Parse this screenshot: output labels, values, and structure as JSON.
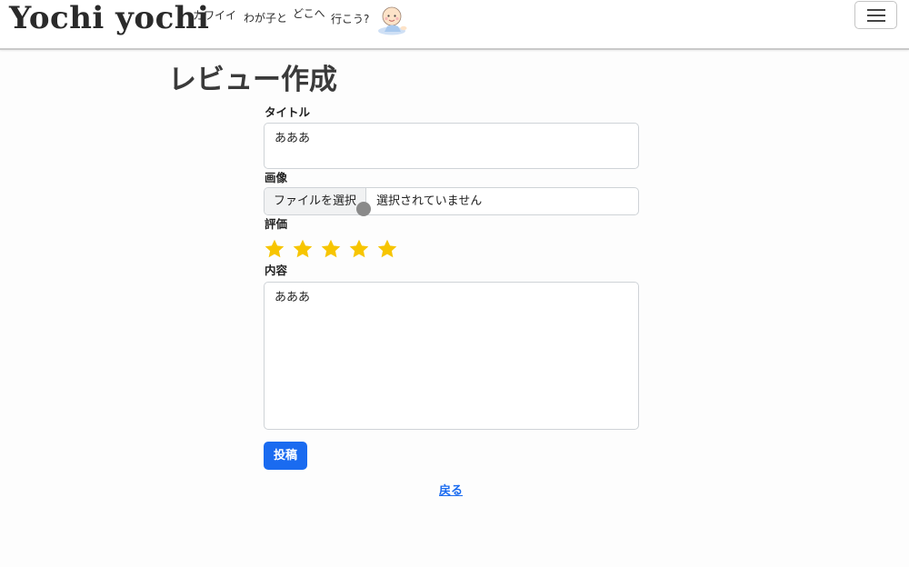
{
  "header": {
    "brand": "Yochi yochi",
    "tagline_parts": [
      "カワイイ",
      "わが子と",
      "どこへ",
      "行こう?"
    ]
  },
  "page": {
    "title": "レビュー作成"
  },
  "form": {
    "title_label": "タイトル",
    "title_value": "あああ",
    "image_label": "画像",
    "file_button_label": "ファイルを選択",
    "file_status": "選択されていません",
    "rating_label": "評価",
    "rating": {
      "value": 5,
      "max": 5,
      "color": "#f7c500"
    },
    "content_label": "内容",
    "content_value": "あああ",
    "submit_label": "投稿"
  },
  "footer": {
    "back_link": "戻る"
  },
  "colors": {
    "primary": "#1a6bf0",
    "star": "#f7c500"
  }
}
